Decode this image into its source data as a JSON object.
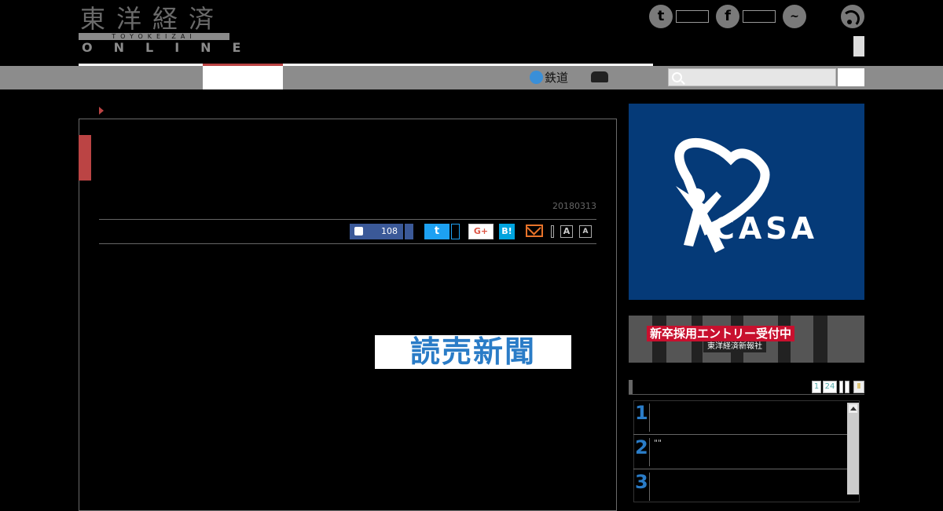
{
  "header": {
    "logo_kanji": "東洋経済",
    "logo_sub": "TOYOKEIZAI",
    "logo_online": "ONLINE",
    "social": [
      "twitter-icon",
      "facebook-icon",
      "messenger-icon",
      "rss-icon"
    ]
  },
  "nav": {
    "rail_label": "鉄道",
    "search_placeholder": ""
  },
  "article": {
    "date": "20180313",
    "share": {
      "like_count": "108",
      "hatena_label": "B!",
      "google_label": "G+",
      "font_large": "A",
      "font_small": "A"
    },
    "paragraphs": [
      "",
      "",
      ""
    ]
  },
  "ads": {
    "yomiuri_label": "読売新聞",
    "casa_label": "CASA",
    "recruit_title": "新卒採用エントリー受付中",
    "recruit_sub": "東洋経済新報社"
  },
  "ranking": {
    "tabs": [
      "1",
      "24"
    ],
    "items": [
      {
        "rank": "1",
        "text": ""
      },
      {
        "rank": "2",
        "text": "\"\""
      },
      {
        "rank": "3",
        "text": ""
      }
    ]
  },
  "colors": {
    "accent_red": "#b44444",
    "twitter": "#1da1f2",
    "facebook": "#3b5998",
    "casa_bg": "#053a78"
  }
}
